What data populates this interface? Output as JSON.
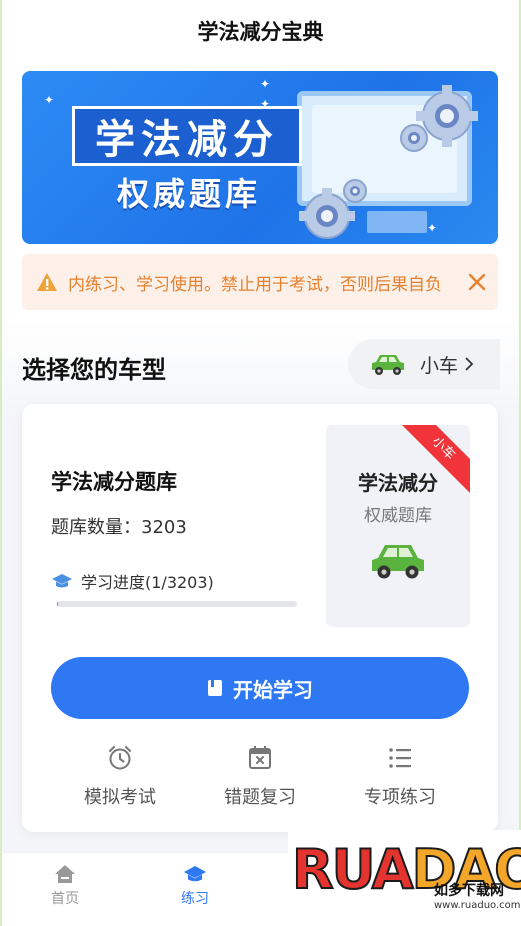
{
  "app": {
    "title": "学法减分宝典"
  },
  "banner": {
    "line1": "学法减分",
    "line2": "权威题库"
  },
  "notice": {
    "text": "内练习、学习使用。禁止用于考试，否则后果自负",
    "color": "#e5812f",
    "icons": [
      "warning-icon",
      "close-icon"
    ]
  },
  "vehicle_select": {
    "title": "选择您的车型",
    "current": "小车",
    "icon": "car-icon"
  },
  "question_bank": {
    "name": "学法减分题库",
    "count_label": "题库数量：3203",
    "progress_label": "学习进度(1/3203)",
    "progress_fraction": 0.0003,
    "thumb_title": "学法减分",
    "thumb_subtitle": "权威题库",
    "ribbon": "小车"
  },
  "start_button": {
    "label": "开始学习",
    "color": "#2e78f3"
  },
  "actions": [
    {
      "label": "模拟考试",
      "icon": "alarm-clock-icon"
    },
    {
      "label": "错题复习",
      "icon": "calendar-x-icon"
    },
    {
      "label": "专项练习",
      "icon": "list-icon"
    }
  ],
  "tabs": [
    {
      "label": "首页",
      "icon": "home-icon",
      "active": false
    },
    {
      "label": "练习",
      "icon": "graduation-cap-icon",
      "active": true
    }
  ],
  "watermark": {
    "logo": "RUANDAO",
    "name": "如多下载网",
    "url": "www.ruaduo.com"
  }
}
